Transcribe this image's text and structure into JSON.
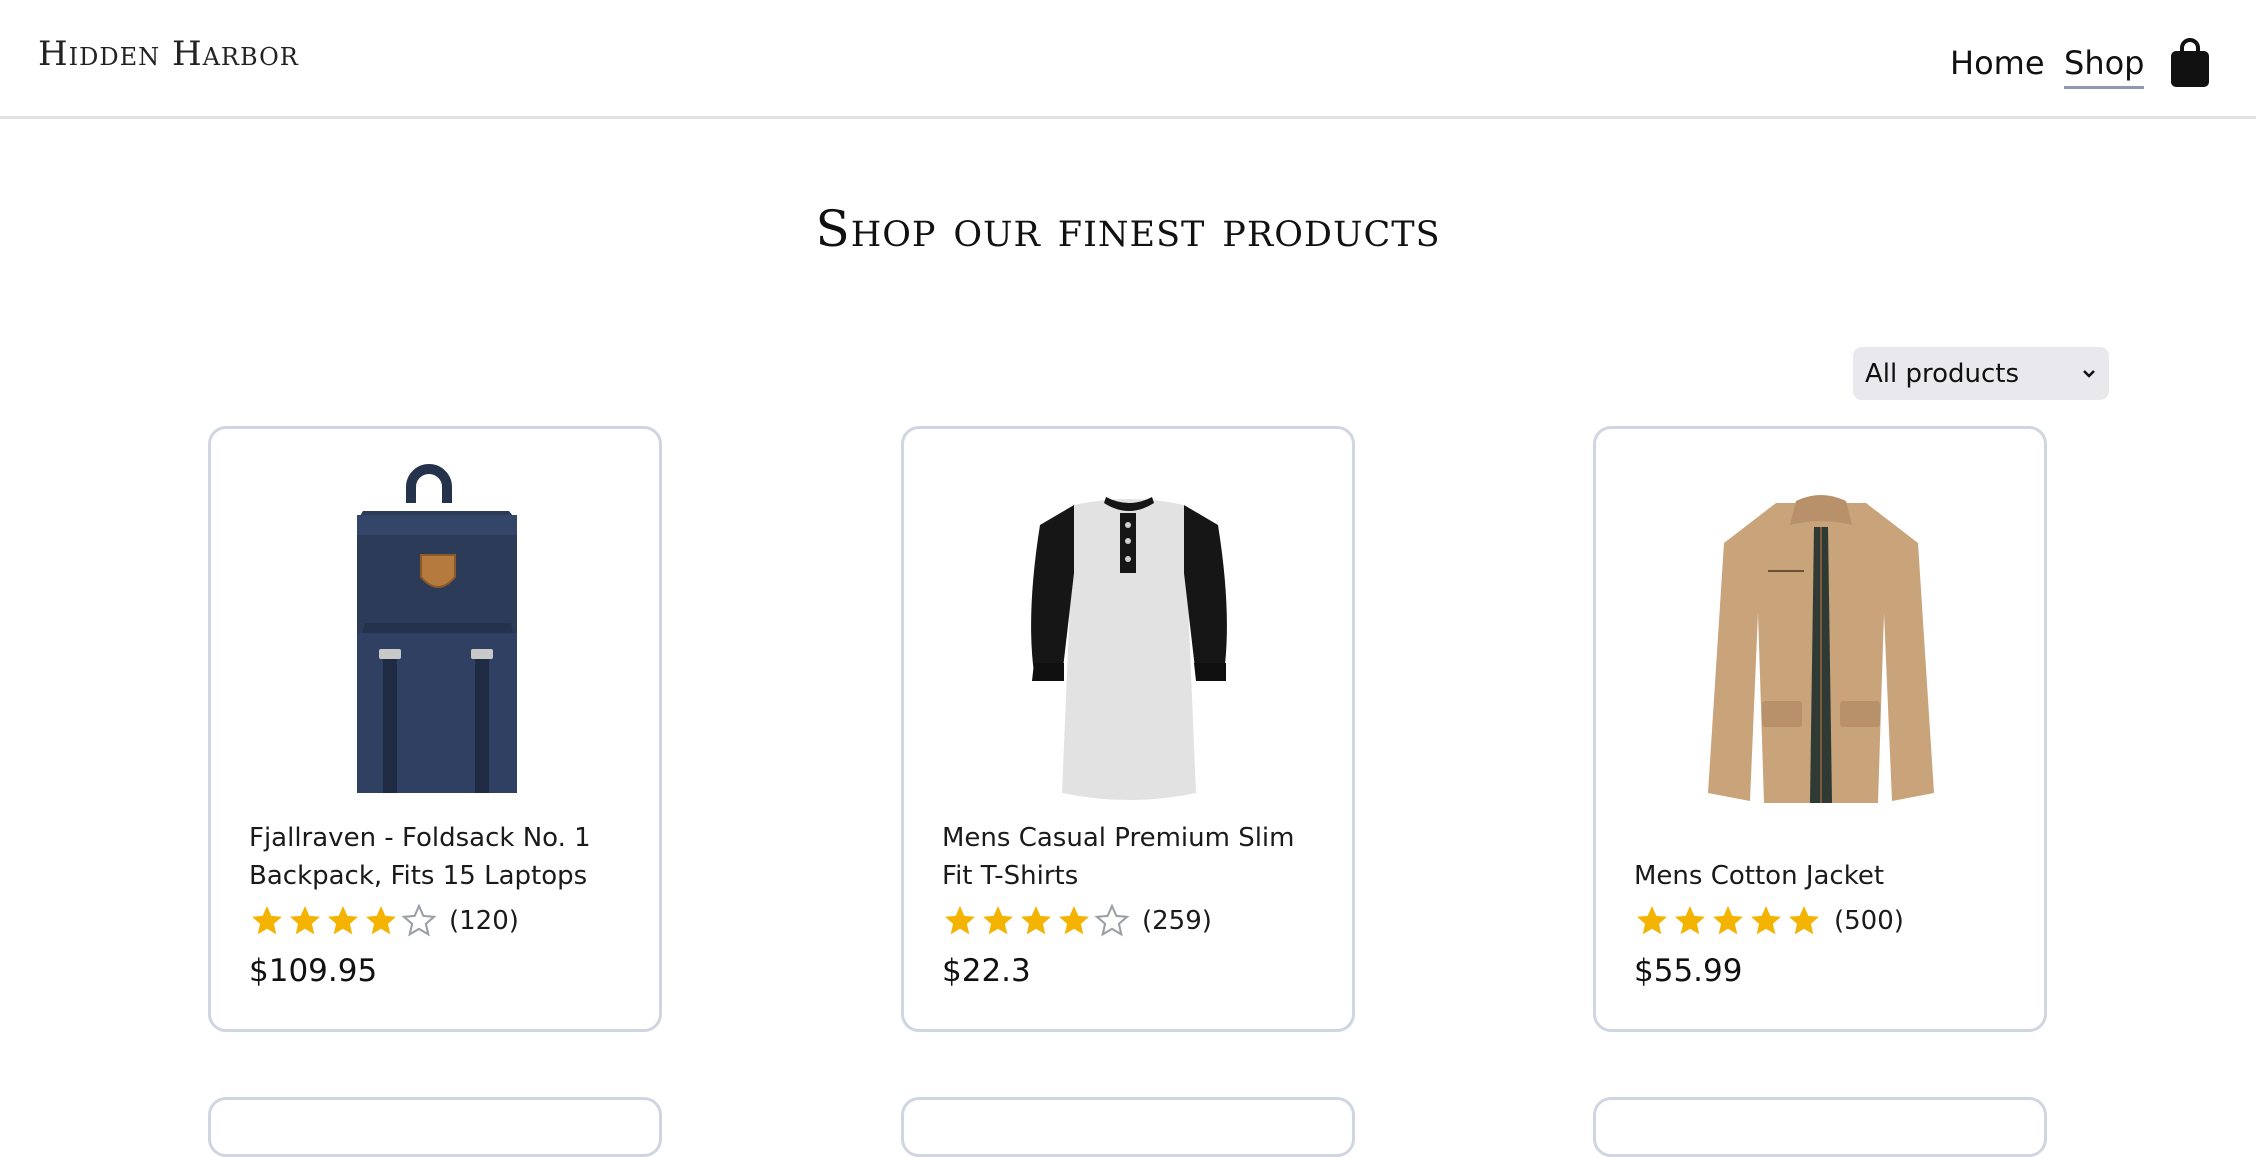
{
  "header": {
    "brand": "Hidden Harbor",
    "nav": {
      "home": "Home",
      "shop": "Shop"
    },
    "cart_icon": "shopping-bag-icon"
  },
  "main": {
    "title": "Shop our finest products",
    "filter": {
      "selected": "All products"
    },
    "products": [
      {
        "name": "Fjallraven - Foldsack No. 1 Backpack, Fits 15 Laptops",
        "rating": 4,
        "rating_count": "(120)",
        "price": "$109.95",
        "image": "navy backpack"
      },
      {
        "name": "Mens Casual Premium Slim Fit T-Shirts",
        "rating": 4,
        "rating_count": "(259)",
        "price": "$22.3",
        "image": "raglan henley t-shirt"
      },
      {
        "name": "Mens Cotton Jacket",
        "rating": 5,
        "rating_count": "(500)",
        "price": "$55.99",
        "image": "khaki cotton jacket"
      }
    ]
  },
  "colors": {
    "star": "#f5b301",
    "star_empty": "#9aa0a6",
    "card_border": "#cfd6e2",
    "nav_underline": "#8f97b3"
  }
}
